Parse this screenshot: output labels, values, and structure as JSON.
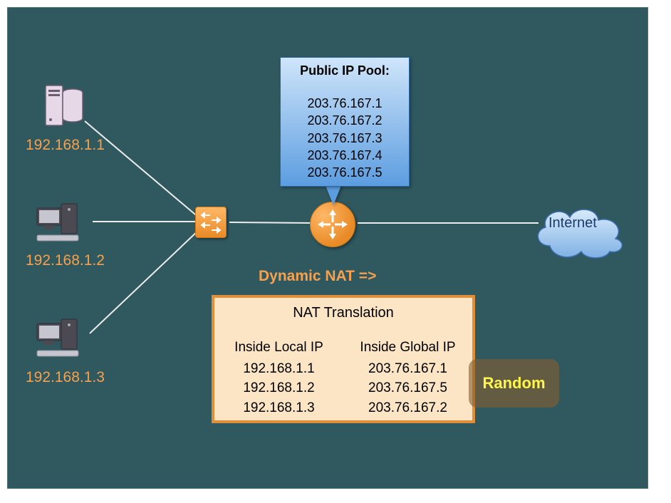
{
  "hosts": [
    {
      "ip": "192.168.1.1",
      "kind": "server"
    },
    {
      "ip": "192.168.1.2",
      "kind": "pc"
    },
    {
      "ip": "192.168.1.3",
      "kind": "pc"
    }
  ],
  "pool": {
    "title": "Public IP Pool:",
    "ips": "203.76.167.1\n203.76.167.2\n203.76.167.3\n203.76.167.4\n203.76.167.5"
  },
  "nat_label": "Dynamic NAT =>",
  "nat_table": {
    "title": "NAT Translation",
    "col_local": "Inside Local IP",
    "col_global": "Inside Global IP",
    "rows": [
      {
        "local": "192.168.1.1",
        "global": "203.76.167.1"
      },
      {
        "local": "192.168.1.2",
        "global": "203.76.167.5"
      },
      {
        "local": "192.168.1.3",
        "global": "203.76.167.2"
      }
    ]
  },
  "random_label": "Random",
  "internet_label": "Internet"
}
